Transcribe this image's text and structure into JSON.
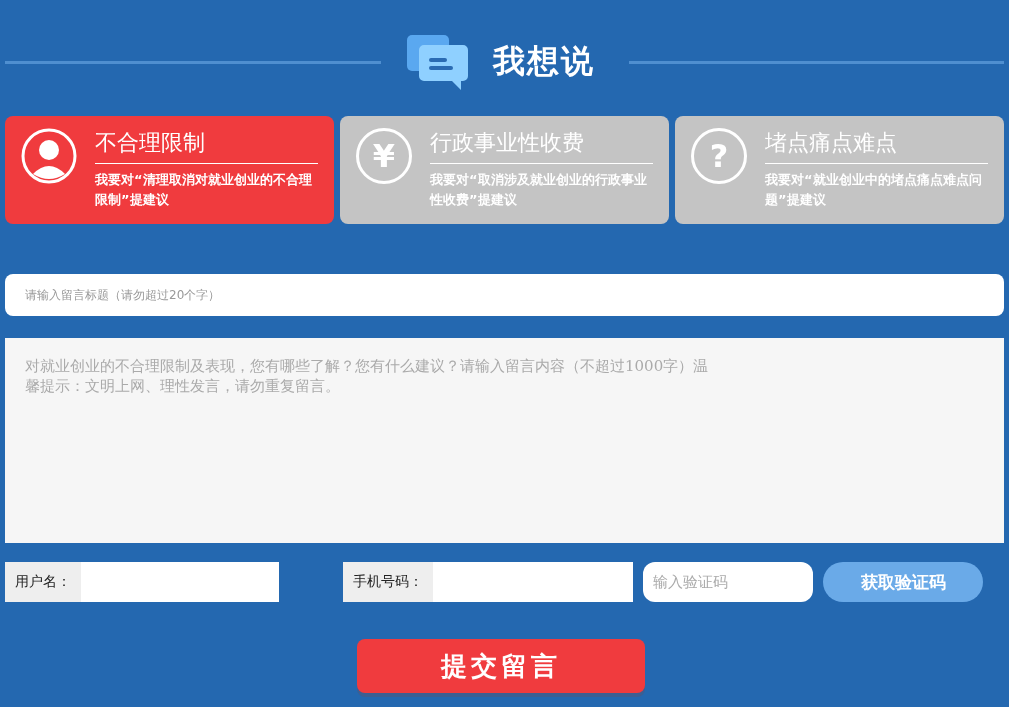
{
  "header": {
    "title": "我想说"
  },
  "tabs": [
    {
      "title": "不合理限制",
      "desc": "我要对“清理取消对就业创业的不合理限制”提建议",
      "selected": true,
      "kind": "person"
    },
    {
      "title": "行政事业性收费",
      "desc": "我要对“取消涉及就业创业的行政事业性收费”提建议",
      "selected": false,
      "kind": "glyph",
      "glyph": "¥"
    },
    {
      "title": "堵点痛点难点",
      "desc": "我要对“就业创业中的堵点痛点难点问题”提建议",
      "selected": false,
      "kind": "glyph",
      "glyph": "?"
    }
  ],
  "subject": {
    "placeholder": "请输入留言标题（请勿超过20个字）"
  },
  "content": {
    "placeholder": "对就业创业的不合理限制及表现，您有哪些了解？您有什么建议？请输入留言内容（不超过1000字）温馨提示：文明上网、理性发言，请勿重复留言。"
  },
  "username": {
    "label": "用户名："
  },
  "phone": {
    "label": "手机号码："
  },
  "code": {
    "placeholder": "输入验证码"
  },
  "get_code_button": "获取验证码",
  "submit_button": "提交留言"
}
